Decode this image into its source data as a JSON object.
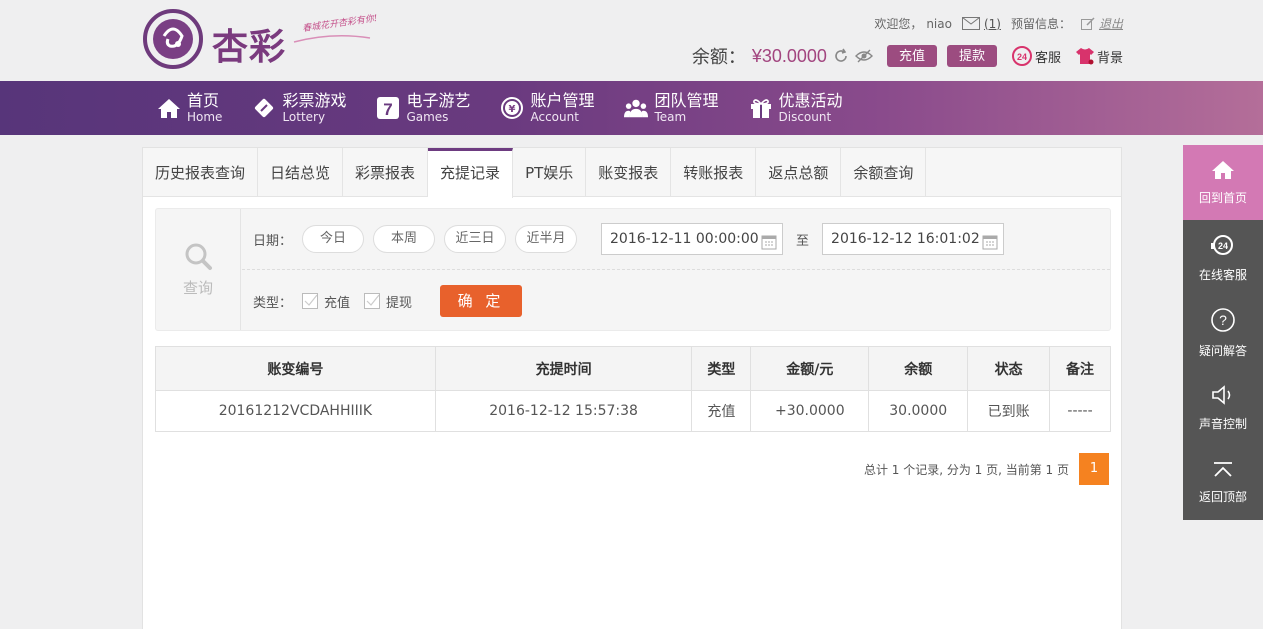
{
  "header": {
    "logo": {
      "name": "杏彩",
      "slogan": "春城花开杏彩有你!"
    },
    "user": {
      "welcome": "欢迎您，",
      "username": "niao",
      "mail_count": "(1)",
      "reserved_info": "预留信息：",
      "logout": "退出"
    },
    "balance": {
      "label": "余额：",
      "amount": "¥30.0000",
      "recharge": "充值",
      "withdraw": "提款",
      "service": "客服",
      "background": "背景"
    }
  },
  "nav": [
    {
      "cn": "首页",
      "en": "Home",
      "icon": "home-icon"
    },
    {
      "cn": "彩票游戏",
      "en": "Lottery",
      "icon": "ticket-icon"
    },
    {
      "cn": "电子游艺",
      "en": "Games",
      "icon": "seven-icon"
    },
    {
      "cn": "账户管理",
      "en": "Account",
      "icon": "yen-coin-icon"
    },
    {
      "cn": "团队管理",
      "en": "Team",
      "icon": "team-icon"
    },
    {
      "cn": "优惠活动",
      "en": "Discount",
      "icon": "gift-icon"
    }
  ],
  "tabs": [
    "历史报表查询",
    "日结总览",
    "彩票报表",
    "充提记录",
    "PT娱乐",
    "账变报表",
    "转账报表",
    "返点总额",
    "余额查询"
  ],
  "active_tab": "充提记录",
  "query": {
    "label": "查询",
    "date_label": "日期：",
    "presets": [
      "今日",
      "本周",
      "近三日",
      "近半月"
    ],
    "start": "2016-12-11 00:00:00",
    "to": "至",
    "end": "2016-12-12 16:01:02",
    "type_label": "类型：",
    "types": [
      "充值",
      "提现"
    ],
    "confirm": "确 定"
  },
  "table": {
    "headers": [
      "账变编号",
      "充提时间",
      "类型",
      "金额/元",
      "余额",
      "状态",
      "备注"
    ],
    "rows": [
      {
        "id": "20161212VCDAHHIIIK",
        "time": "2016-12-12 15:57:38",
        "type": "充值",
        "amount": "+30.0000",
        "balance": "30.0000",
        "status": "已到账",
        "note": "-----"
      }
    ]
  },
  "pager": {
    "summary": "总计 1 个记录, 分为 1 页, 当前第 1 页",
    "current": "1"
  },
  "sidebar": [
    {
      "label": "回到首页",
      "icon": "home-icon"
    },
    {
      "label": "在线客服",
      "icon": "headset-icon"
    },
    {
      "label": "疑问解答",
      "icon": "question-icon"
    },
    {
      "label": "声音控制",
      "icon": "speaker-icon"
    },
    {
      "label": "返回顶部",
      "icon": "back-to-top-icon"
    }
  ],
  "colors": {
    "accent": "#6d3b80",
    "amount": "#a2457f",
    "confirm": "#e8612c",
    "page": "#f58220",
    "sidebar_active": "#d379b4"
  }
}
